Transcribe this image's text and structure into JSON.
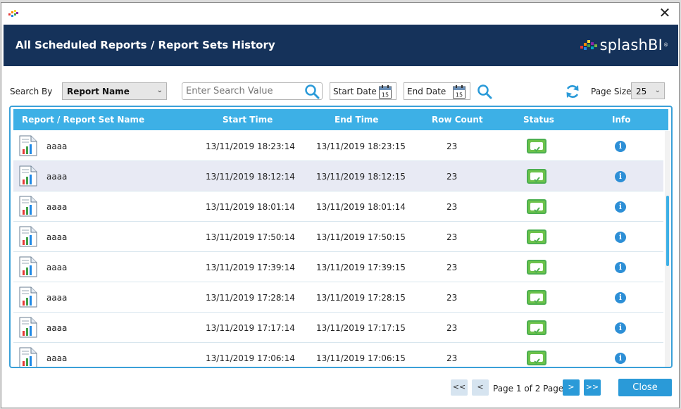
{
  "header": {
    "title": "All Scheduled Reports / Report Sets History",
    "brand": "splashBI",
    "brand_mark": "®"
  },
  "window": {
    "close_symbol": "✕"
  },
  "toolbar": {
    "search_by_label": "Search By",
    "search_by_value": "Report Name",
    "search_placeholder": "Enter Search Value",
    "start_date_label": "Start Date",
    "end_date_label": "End Date",
    "calendar_day": "15",
    "page_size_label": "Page Size",
    "page_size_value": "25"
  },
  "grid": {
    "columns": [
      "Report / Report Set Name",
      "Start Time",
      "End Time",
      "Row Count",
      "Status",
      "Info"
    ],
    "rows": [
      {
        "name": "aaaa",
        "start": "13/11/2019 18:23:14",
        "end": "13/11/2019 18:23:15",
        "count": "23"
      },
      {
        "name": "aaaa",
        "start": "13/11/2019 18:12:14",
        "end": "13/11/2019 18:12:15",
        "count": "23"
      },
      {
        "name": "aaaa",
        "start": "13/11/2019 18:01:14",
        "end": "13/11/2019 18:01:14",
        "count": "23"
      },
      {
        "name": "aaaa",
        "start": "13/11/2019 17:50:14",
        "end": "13/11/2019 17:50:15",
        "count": "23"
      },
      {
        "name": "aaaa",
        "start": "13/11/2019 17:39:14",
        "end": "13/11/2019 17:39:15",
        "count": "23"
      },
      {
        "name": "aaaa",
        "start": "13/11/2019 17:28:14",
        "end": "13/11/2019 17:28:15",
        "count": "23"
      },
      {
        "name": "aaaa",
        "start": "13/11/2019 17:17:14",
        "end": "13/11/2019 17:17:15",
        "count": "23"
      },
      {
        "name": "aaaa",
        "start": "13/11/2019 17:06:14",
        "end": "13/11/2019 17:06:15",
        "count": "23"
      }
    ],
    "info_glyph": "i"
  },
  "pager": {
    "first": "<<",
    "prev": "<",
    "next": ">",
    "last": ">>",
    "text": "Page 1 of 2 Pages",
    "close_label": "Close"
  },
  "colors": {
    "header_bg": "#15325a",
    "accent": "#3db0e6",
    "button": "#2a9ad8",
    "status_ok": "#6cc24a"
  }
}
